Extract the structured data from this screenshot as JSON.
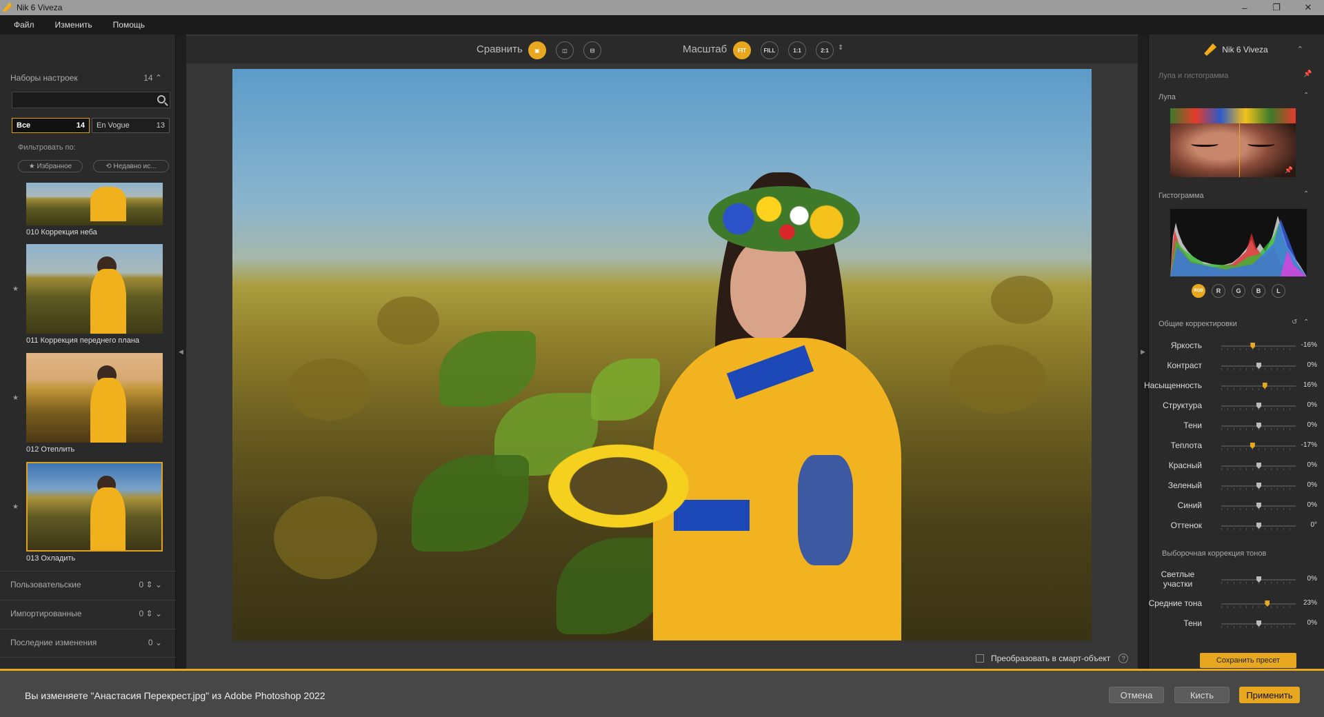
{
  "window": {
    "title": "Nik 6 Viveza",
    "min": "–",
    "max": "❐",
    "close": "✕"
  },
  "menu": [
    "Файл",
    "Изменить",
    "Помощь"
  ],
  "left": {
    "presets_title": "Наборы настроек",
    "presets_count": "14",
    "search_placeholder": "",
    "tabs": [
      {
        "label": "Все",
        "count": "14"
      },
      {
        "label": "En Vogue",
        "count": "13"
      }
    ],
    "filter_label": "Фильтровать по:",
    "filter_favorites": "★ Избранное",
    "filter_recent": "⟲ Недавно ис...",
    "presets": [
      {
        "label": "010 Коррекция неба",
        "style": "normal"
      },
      {
        "label": "011 Коррекция переднего плана",
        "style": "normal"
      },
      {
        "label": "012 Отеплить",
        "style": "warm"
      },
      {
        "label": "013 Охладить",
        "style": "cool"
      }
    ],
    "sections": [
      {
        "label": "Пользовательские",
        "count": "0"
      },
      {
        "label": "Импортированные",
        "count": "0"
      },
      {
        "label": "Последние изменения",
        "count": "0"
      }
    ]
  },
  "toolbar": {
    "compare_label": "Сравнить",
    "zoom_label": "Масштаб",
    "zoom_options": [
      "FIT",
      "FILL",
      "1:1",
      "2:1"
    ]
  },
  "canvas": {
    "smart_object_label": "Преобразовать в смарт-объект",
    "help": "?"
  },
  "right": {
    "brand": "Nik 6 Viveza",
    "loupe_histogram_title": "Лупа и гистограмма",
    "loupe_title": "Лупа",
    "histogram_title": "Гистограмма",
    "histogram_channels": [
      "RGB",
      "R",
      "G",
      "B",
      "L"
    ],
    "global_title": "Общие корректировки",
    "adjustments": [
      {
        "label": "Яркость",
        "value": "-16%",
        "level": -16
      },
      {
        "label": "Контраст",
        "value": "0%",
        "level": 0
      },
      {
        "label": "Насыщенность",
        "value": "16%",
        "level": 16
      },
      {
        "label": "Структура",
        "value": "0%",
        "level": 0
      },
      {
        "label": "Тени",
        "value": "0%",
        "level": 0
      },
      {
        "label": "Теплота",
        "value": "-17%",
        "level": -17
      },
      {
        "label": "Красный",
        "value": "0%",
        "level": 0
      },
      {
        "label": "Зеленый",
        "value": "0%",
        "level": 0
      },
      {
        "label": "Синий",
        "value": "0%",
        "level": 0
      },
      {
        "label": "Оттенок",
        "value": "0°",
        "level": 0
      }
    ],
    "selective_title": "Выборочная коррекция тонов",
    "selective": [
      {
        "label": "Светлые участки",
        "value": "0%",
        "level": 0
      },
      {
        "label": "Средние тона",
        "value": "23%",
        "level": 23
      },
      {
        "label": "Тени",
        "value": "0%",
        "level": 0
      }
    ],
    "save_preset": "Сохранить пресет"
  },
  "footer": {
    "message": "Вы изменяете \"Анастасия Перекрест.jpg\" из Adobe Photoshop 2022",
    "cancel": "Отмена",
    "brush": "Кисть",
    "apply": "Применить"
  },
  "colors": {
    "accent": "#e7a81f",
    "panel": "#2a2a2a",
    "canvas_bg": "#363636"
  }
}
